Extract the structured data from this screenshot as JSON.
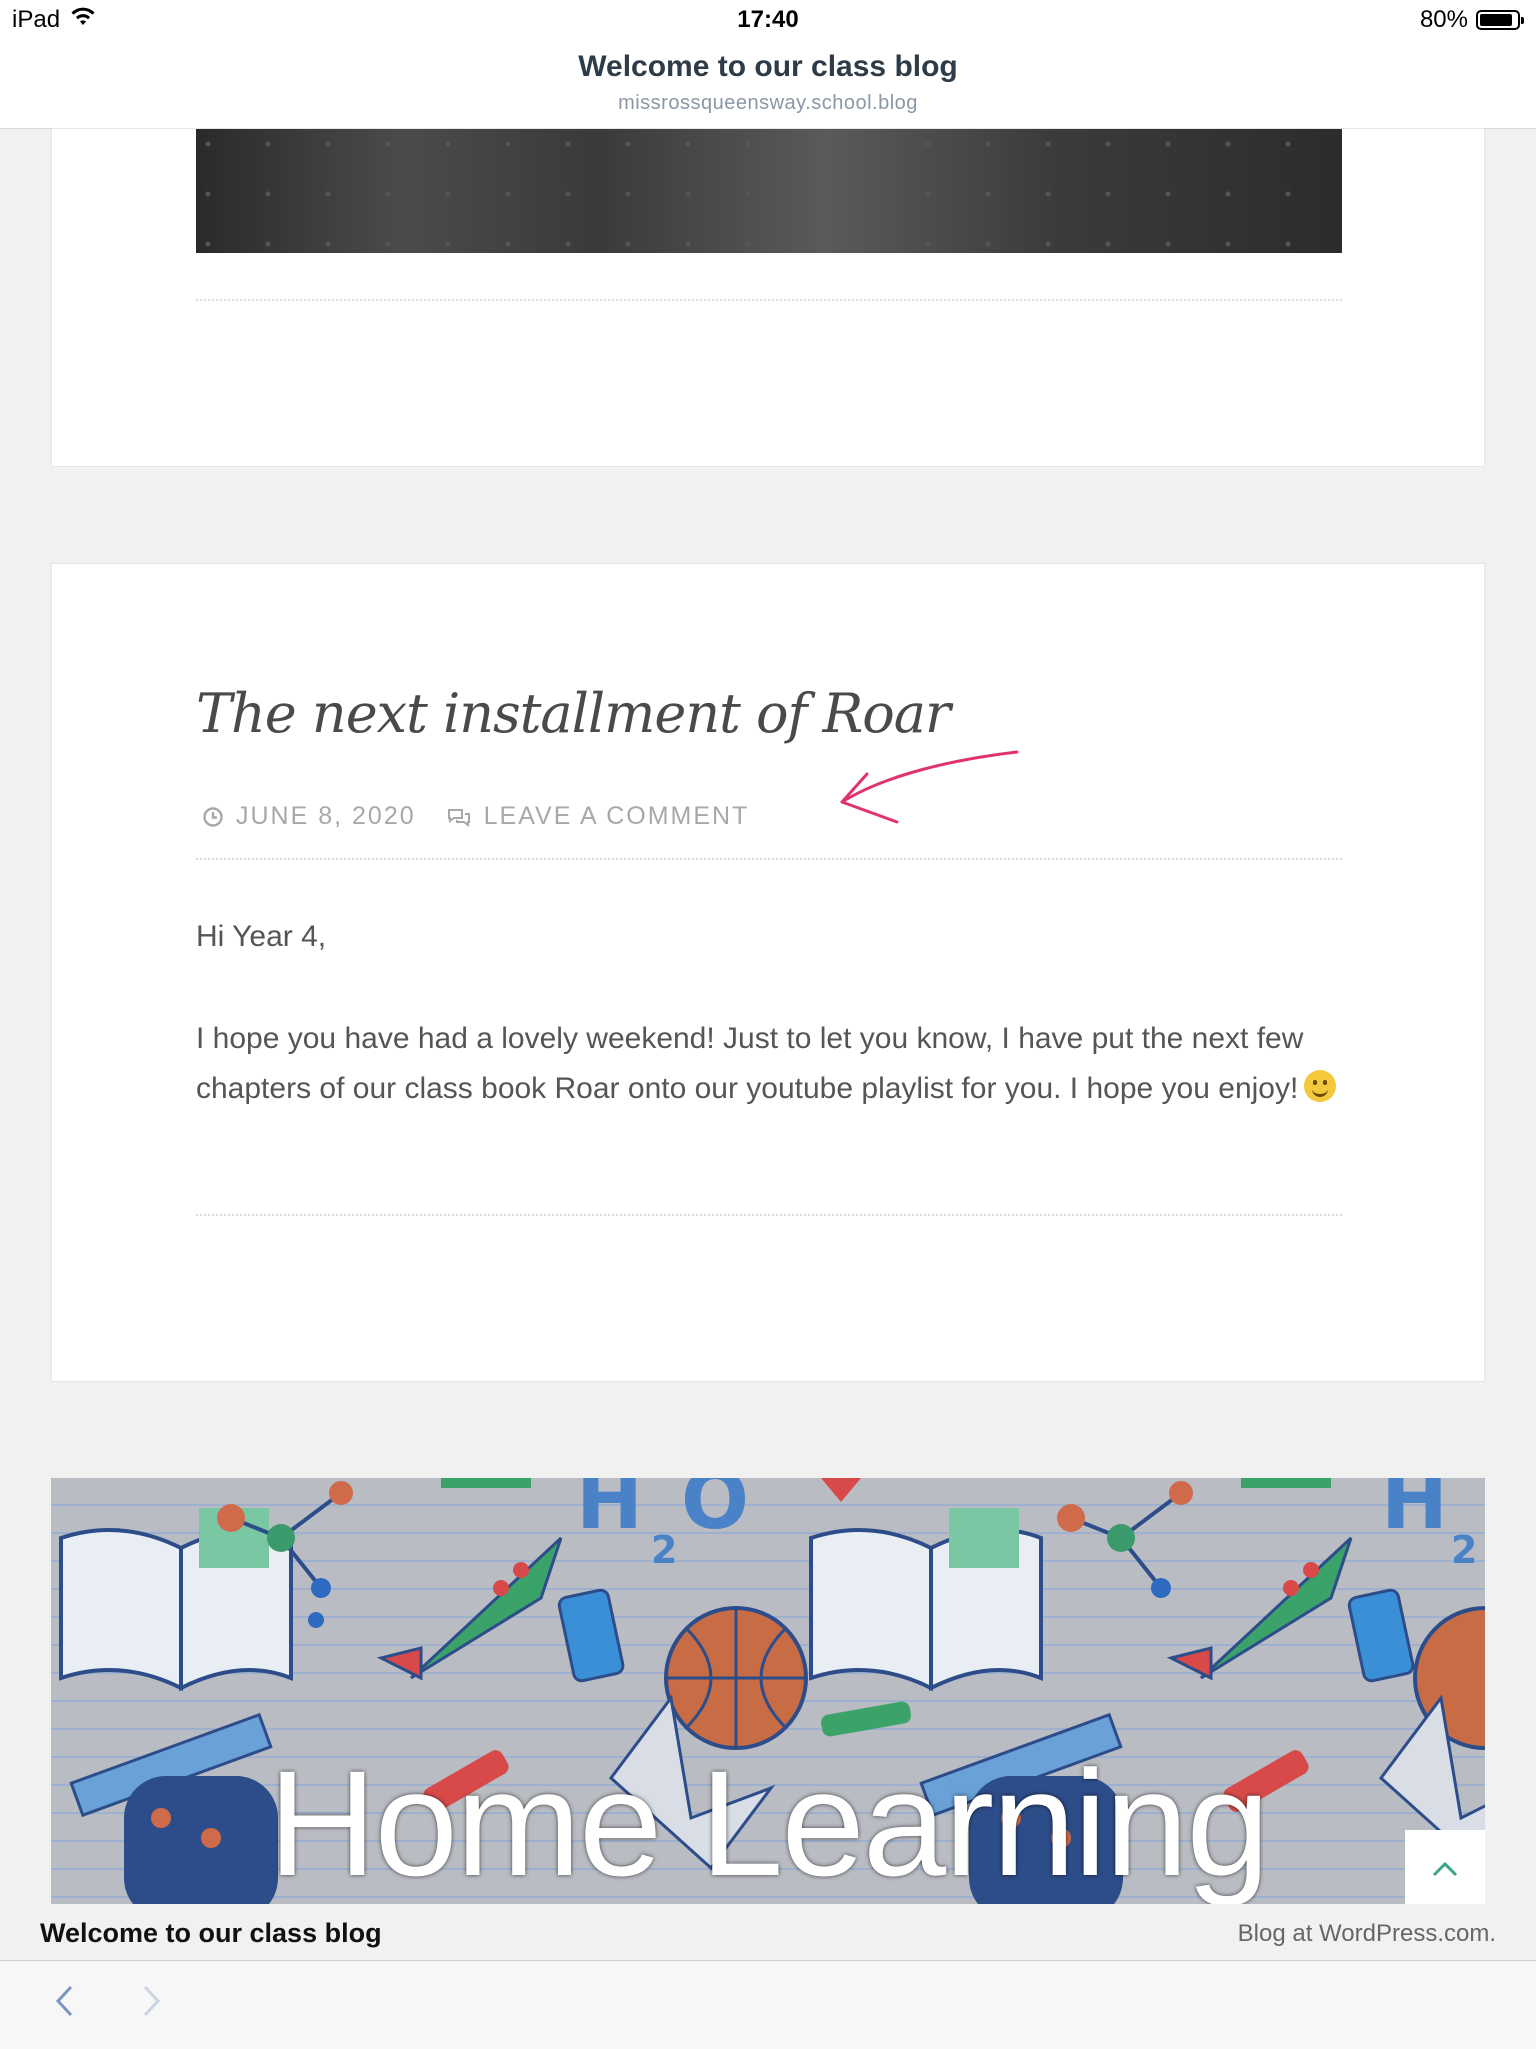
{
  "status": {
    "device": "iPad",
    "time": "17:40",
    "battery": "80%",
    "battery_level": 0.8
  },
  "header": {
    "title": "Welcome to our class blog",
    "url": "missrossqueensway.school.blog"
  },
  "post": {
    "title": "The next installment of Roar",
    "date": "JUNE 8, 2020",
    "comment_link": "LEAVE A COMMENT",
    "greeting": "Hi Year 4,",
    "body": "I hope you have had a lovely weekend! Just to let you know, I have put the next few chapters of our class book Roar onto our youtube playlist for you. I hope you enjoy!"
  },
  "banner": {
    "text": "Home Learning"
  },
  "footer": {
    "site_name": "Welcome to our class blog",
    "credit": "Blog at WordPress.com."
  },
  "colors": {
    "annotation_arrow": "#e0336e",
    "header_title": "#2e3b48",
    "meta_text": "#a8a8a8"
  }
}
